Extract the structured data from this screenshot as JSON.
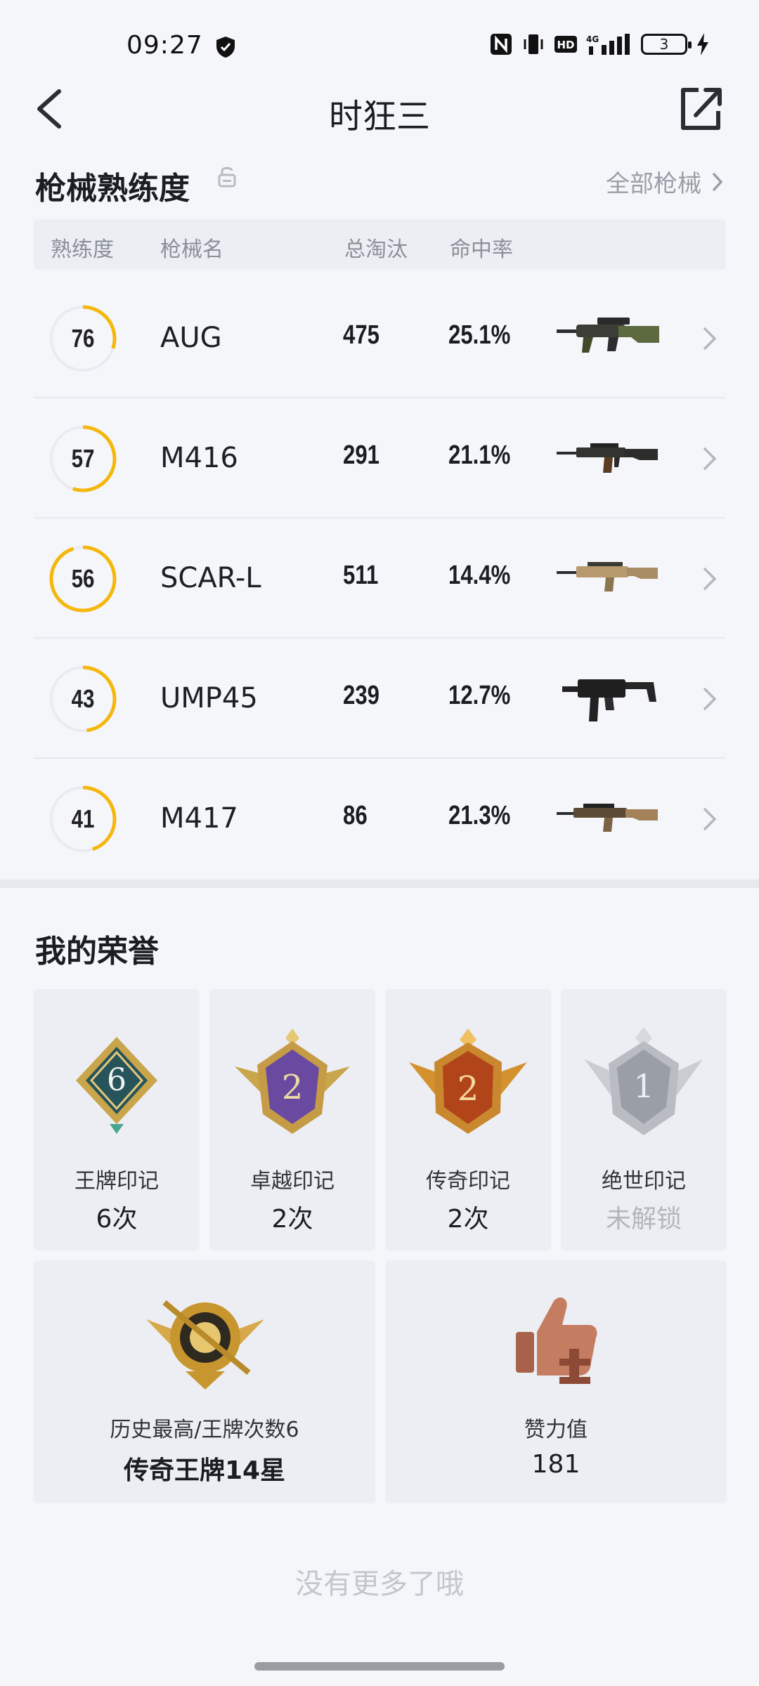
{
  "status_bar": {
    "time": "09:27",
    "network": "4G",
    "battery": "3",
    "icons": [
      "shield-icon",
      "nfc-icon",
      "vibrate-icon",
      "hd-icon",
      "signal-icon",
      "battery-icon",
      "charging-icon"
    ]
  },
  "header": {
    "title": "时狂三",
    "back_icon": "back-arrow-icon",
    "share_icon": "share-external-icon"
  },
  "weapons": {
    "section_title": "枪械熟练度",
    "all_link": "全部枪械",
    "columns": {
      "proficiency": "熟练度",
      "name": "枪械名",
      "kills": "总淘汰",
      "hit_rate": "命中率"
    },
    "rows": [
      {
        "proficiency": "76",
        "name": "AUG",
        "kills": "475",
        "hit_rate": "25.1%",
        "gun_icon": "aug-rifle-icon",
        "ring_fraction": 0.3
      },
      {
        "proficiency": "57",
        "name": "M416",
        "kills": "291",
        "hit_rate": "21.1%",
        "gun_icon": "m416-rifle-icon",
        "ring_fraction": 0.55
      },
      {
        "proficiency": "56",
        "name": "SCAR-L",
        "kills": "511",
        "hit_rate": "14.4%",
        "gun_icon": "scar-l-rifle-icon",
        "ring_fraction": 0.95
      },
      {
        "proficiency": "43",
        "name": "UMP45",
        "kills": "239",
        "hit_rate": "12.7%",
        "gun_icon": "ump45-smg-icon",
        "ring_fraction": 0.48
      },
      {
        "proficiency": "41",
        "name": "M417",
        "kills": "86",
        "hit_rate": "21.3%",
        "gun_icon": "m417-rifle-icon",
        "ring_fraction": 0.45
      }
    ],
    "colors": {
      "ring": "#f5b70c",
      "ring_track": "#e9ebf0"
    }
  },
  "honors": {
    "section_title": "我的荣誉",
    "badges": [
      {
        "name": "王牌印记",
        "value": "6次",
        "medal_number": "6",
        "icon": "ace-mark-medal-icon"
      },
      {
        "name": "卓越印记",
        "value": "2次",
        "medal_number": "2",
        "icon": "excellence-mark-medal-icon"
      },
      {
        "name": "传奇印记",
        "value": "2次",
        "medal_number": "2",
        "icon": "legend-mark-medal-icon"
      },
      {
        "name": "绝世印记",
        "value": "未解锁",
        "medal_number": "1",
        "icon": "peerless-mark-medal-icon",
        "locked": true
      }
    ],
    "history": {
      "label": "历史最高/王牌次数6",
      "value": "传奇王牌14星",
      "icon": "legend-ace-emblem-icon"
    },
    "likes": {
      "label": "赞力值",
      "value": "181",
      "icon": "thumbs-up-icon"
    }
  },
  "footer": {
    "no_more": "没有更多了哦"
  }
}
